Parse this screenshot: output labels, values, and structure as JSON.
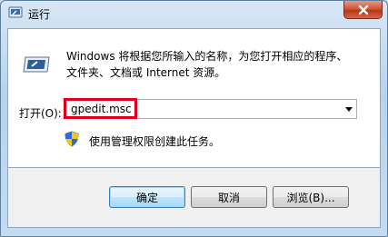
{
  "window": {
    "title": "运行"
  },
  "description": {
    "line1": "Windows 将根据您所输入的名称，为您打开相应的程序、",
    "line2": "文件夹、文档或 Internet 资源。"
  },
  "open_field": {
    "label": "打开(O):",
    "value": "gpedit.msc"
  },
  "admin_note": "使用管理权限创建此任务。",
  "buttons": {
    "ok": "确定",
    "cancel": "取消",
    "browse": "浏览(B)..."
  },
  "colors": {
    "highlight": "#e0001e",
    "close_button": "#c9502f"
  },
  "icons": [
    "run-dialog-icon",
    "close-icon",
    "dropdown-arrow-icon",
    "uac-shield-icon"
  ]
}
